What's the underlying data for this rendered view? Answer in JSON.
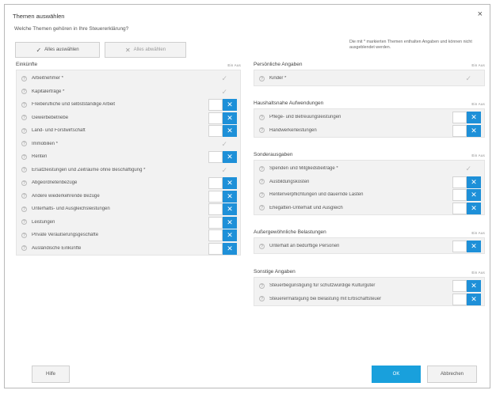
{
  "dialog": {
    "title": "Themen auswählen",
    "close_symbol": "×",
    "question": "Welche Themen gehören in Ihre Steuererklärung?",
    "select_all": "Alles auswählen",
    "select_all_icon": "✓",
    "deselect_all": "Alles abwählen",
    "deselect_all_icon": "✕",
    "note": "Die mit * markierten Themen enthalten Angaben und können nicht ausgeblendet werden.",
    "col_on": "Ein",
    "col_off": "Aus",
    "help_symbol": "?",
    "toggle_symbol": "✕",
    "check_symbol": "✓"
  },
  "left": {
    "title": "Einkünfte",
    "items": [
      {
        "label": "Arbeitnehmer *",
        "state": "mandatory"
      },
      {
        "label": "Kapitalerträge *",
        "state": "mandatory"
      },
      {
        "label": "Freiberufliche und selbstständige Arbeit",
        "state": "off"
      },
      {
        "label": "Gewerbebetriebe",
        "state": "off"
      },
      {
        "label": "Land- und Forstwirtschaft",
        "state": "off"
      },
      {
        "label": "Immobilien *",
        "state": "mandatory"
      },
      {
        "label": "Renten",
        "state": "off"
      },
      {
        "label": "Ersatzleistungen und Zeiträume ohne Beschäftigung *",
        "state": "mandatory"
      },
      {
        "label": "Abgeordnetenbezüge",
        "state": "off"
      },
      {
        "label": "Andere wiederkehrende Bezüge",
        "state": "off"
      },
      {
        "label": "Unterhalts- und Ausgleichsleistungen",
        "state": "off"
      },
      {
        "label": "Leistungen",
        "state": "off"
      },
      {
        "label": "Private Veräußerungsgeschäfte",
        "state": "off"
      },
      {
        "label": "Ausländische Einkünfte",
        "state": "off"
      }
    ]
  },
  "right": {
    "sections": [
      {
        "title": "Persönliche Angaben",
        "items": [
          {
            "label": "Kinder *",
            "state": "mandatory"
          }
        ]
      },
      {
        "title": "Haushaltsnahe Aufwendungen",
        "items": [
          {
            "label": "Pflege- und Betreuungsleistungen",
            "state": "off"
          },
          {
            "label": "Handwerkerleistungen",
            "state": "off"
          }
        ]
      },
      {
        "title": "Sonderausgaben",
        "items": [
          {
            "label": "Spenden und Mitgliedsbeiträge *",
            "state": "mandatory"
          },
          {
            "label": "Ausbildungskosten",
            "state": "off"
          },
          {
            "label": "Rentenverpflichtungen und dauernde Lasten",
            "state": "off"
          },
          {
            "label": "Ehegatten-Unterhalt und Ausgleich",
            "state": "off"
          }
        ]
      },
      {
        "title": "Außergewöhnliche Belastungen",
        "items": [
          {
            "label": "Unterhalt an bedürftige Personen",
            "state": "off"
          }
        ]
      },
      {
        "title": "Sonstige Angaben",
        "items": [
          {
            "label": "Steuerbegünstigung für schutzwürdige Kulturgüter",
            "state": "off"
          },
          {
            "label": "Steuerermäßigung bei Belastung mit Erbschaftsteuer",
            "state": "off"
          }
        ]
      }
    ]
  },
  "footer": {
    "help": "Hilfe",
    "ok": "OK",
    "cancel": "Abbrechen"
  },
  "colors": {
    "toggle_off": "#1e90d8",
    "ok": "#19a0dc"
  }
}
